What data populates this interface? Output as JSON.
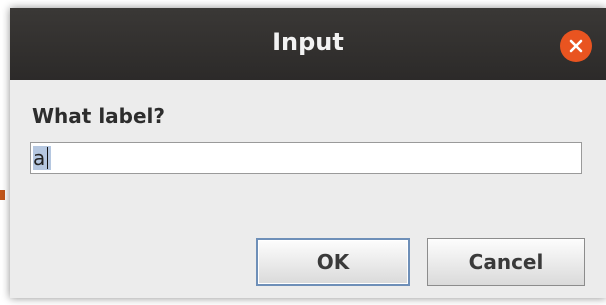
{
  "dialog": {
    "title": "Input",
    "prompt": "What label?",
    "input_value": "a",
    "ok_label": "OK",
    "cancel_label": "Cancel",
    "close_icon": "close-icon"
  },
  "colors": {
    "titlebar": "#2c2a29",
    "close_button": "#e95420",
    "dialog_body": "#ececec",
    "selection": "#b5c7e0",
    "default_button_border": "#6e8fb8"
  }
}
